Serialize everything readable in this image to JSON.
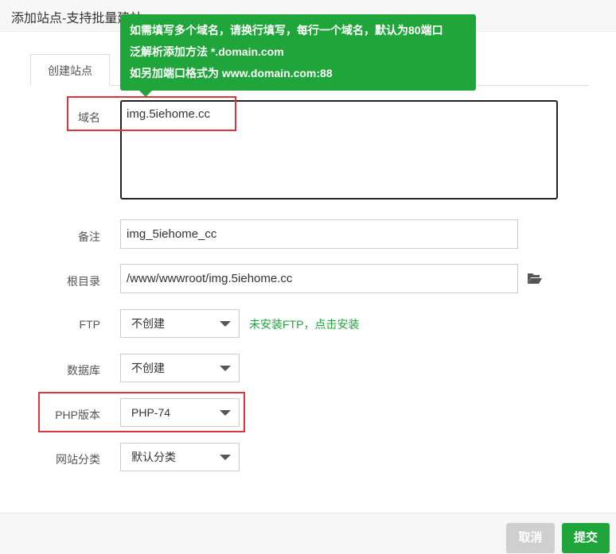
{
  "window": {
    "title": "添加站点-支持批量建站"
  },
  "tooltip": {
    "lines": [
      "如需填写多个域名，请换行填写，每行一个域名，默认为80端口",
      "泛解析添加方法 *.domain.com",
      "如另加端口格式为 www.domain.com:88"
    ]
  },
  "tabs": [
    {
      "label": "创建站点",
      "active": true
    },
    {
      "label": "",
      "active": false
    }
  ],
  "form": {
    "domain": {
      "label": "域名",
      "value": "img.5iehome.cc"
    },
    "remark": {
      "label": "备注",
      "value": "img_5iehome_cc"
    },
    "root": {
      "label": "根目录",
      "value": "/www/wwwroot/img.5iehome.cc",
      "icon": "folder-open-icon"
    },
    "ftp": {
      "label": "FTP",
      "value": "不创建",
      "hint": "未安装FTP，点击安装"
    },
    "database": {
      "label": "数据库",
      "value": "不创建"
    },
    "php": {
      "label": "PHP版本",
      "value": "PHP-74"
    },
    "category": {
      "label": "网站分类",
      "value": "默认分类"
    }
  },
  "footer": {
    "cancel_label": "取消",
    "submit_label": "提交"
  },
  "colors": {
    "accent": "#20a53a",
    "highlight": "#d9363e",
    "disabled": "#cfcfcf"
  }
}
